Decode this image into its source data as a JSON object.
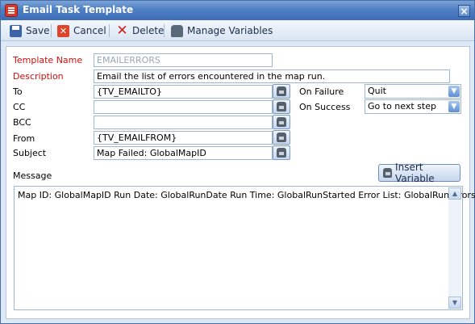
{
  "window": {
    "title": "Email Task Template"
  },
  "toolbar": {
    "save_label": "Save",
    "cancel_label": "Cancel",
    "delete_label": "Delete",
    "manage_variables_label": "Manage Variables"
  },
  "form": {
    "template_name": {
      "label": "Template Name",
      "value": "EMAILERRORS"
    },
    "description": {
      "label": "Description",
      "value": "Email the list of errors encountered in the map run."
    },
    "to": {
      "label": "To",
      "value": "{TV_EMAILTO}"
    },
    "cc": {
      "label": "CC",
      "value": ""
    },
    "bcc": {
      "label": "BCC",
      "value": ""
    },
    "from": {
      "label": "From",
      "value": "{TV_EMAILFROM}"
    },
    "subject": {
      "label": "Subject",
      "value": "Map Failed: GlobalMapID"
    },
    "on_failure": {
      "label": "On Failure",
      "value": "Quit"
    },
    "on_success": {
      "label": "On Success",
      "value": "Go to next step"
    },
    "message": {
      "label": "Message",
      "value": "Map ID:  GlobalMapID Run Date:  GlobalRunDate Run Time:  GlobalRunStarted Error List: GlobalRunErrors"
    }
  },
  "insert_variable_label": "Insert Variable",
  "icons": {
    "app": "template-icon",
    "save": "floppy-disk-icon",
    "cancel": "cancel-x-icon",
    "delete": "delete-x-icon",
    "manage_variables": "phone-icon",
    "picker": "phone-icon"
  },
  "colors": {
    "required_label": "#cc1010",
    "titlebar": "#4f7fc4"
  }
}
